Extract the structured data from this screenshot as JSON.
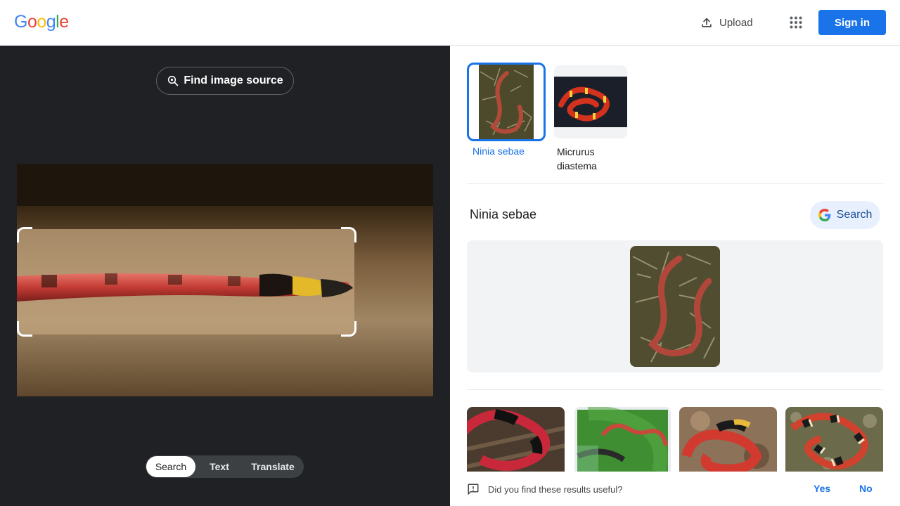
{
  "header": {
    "logo": [
      "G",
      "o",
      "o",
      "g",
      "l",
      "e"
    ],
    "logo_colors": [
      "#4285F4",
      "#EA4335",
      "#FBBC05",
      "#4285F4",
      "#34A853",
      "#EA4335"
    ],
    "upload_label": "Upload",
    "signin_label": "Sign in"
  },
  "left": {
    "find_source_label": "Find image source",
    "tabs": [
      {
        "label": "Search",
        "active": true
      },
      {
        "label": "Text",
        "active": false
      },
      {
        "label": "Translate",
        "active": false
      }
    ]
  },
  "right": {
    "chips": [
      {
        "label": "Ninia sebae",
        "selected": true
      },
      {
        "label": "Micrurus diastema",
        "selected": false
      }
    ],
    "result_title": "Ninia sebae",
    "search_label": "Search",
    "feedback": {
      "question": "Did you find these results useful?",
      "yes": "Yes",
      "no": "No"
    }
  },
  "colors": {
    "accent": "#1a73e8",
    "dark_bg": "#202124"
  }
}
